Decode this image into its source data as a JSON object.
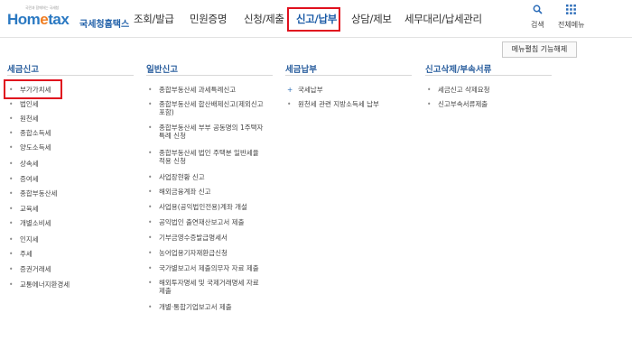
{
  "header": {
    "logo": {
      "tagline": "국민과 함께하는 국세청",
      "main_ho": "Hom",
      "main_e": "e",
      "main_rest": "tax",
      "sub": "국세청홈택스"
    },
    "nav": [
      "조회/발급",
      "민원증명",
      "신청/제출",
      "신고/납부",
      "상담/제보",
      "세무대리/납세관리"
    ],
    "active_nav": "신고/납부",
    "search_label": "검색",
    "all_menu_label": "전체메뉴",
    "highlight_color": "#e0101e"
  },
  "menu_toggle_label": "메뉴펼침 기능해제",
  "columns": {
    "tax_report": {
      "title": "세금신고",
      "items": [
        "부가가치세",
        "법인세",
        "원천세",
        "종합소득세",
        "양도소득세",
        "상속세",
        "증여세",
        "종합부동산세",
        "교육세",
        "개별소비세",
        "인지세",
        "주세",
        "증권거래세",
        "교통에너지환경세"
      ]
    },
    "general_report": {
      "title": "일반신고",
      "items": [
        "종합부동산세 과세특례신고",
        "종합부동산세 합산배제신고(제외신고",
        "포함)",
        "종합부동산세 부부 공동명의 1주택자",
        "특례 신청",
        "종합부동산세 법인 주택분 일반세율",
        "적용 신청",
        "사업장현황 신고",
        "해외금융계좌 신고",
        "사업용(공익법인전용)계좌 개설",
        "공익법인 출연재산보고서 제출",
        "기부금영수증발급명세서",
        "농어업용기자재환급신청",
        "국가별보고서 제출의무자 자료 제출",
        "해외투자명세 및 국제거래명세 자료",
        "제출",
        "개별·통합기업보고서 제출"
      ]
    },
    "tax_payment": {
      "title": "세금납부",
      "items": [
        "국세납부",
        "원천세 관련 지방소득세 납부"
      ]
    },
    "report_delete": {
      "title": "신고삭제/부속서류",
      "items": [
        "세금신고 삭제요청",
        "신고부속서류제출"
      ]
    }
  }
}
